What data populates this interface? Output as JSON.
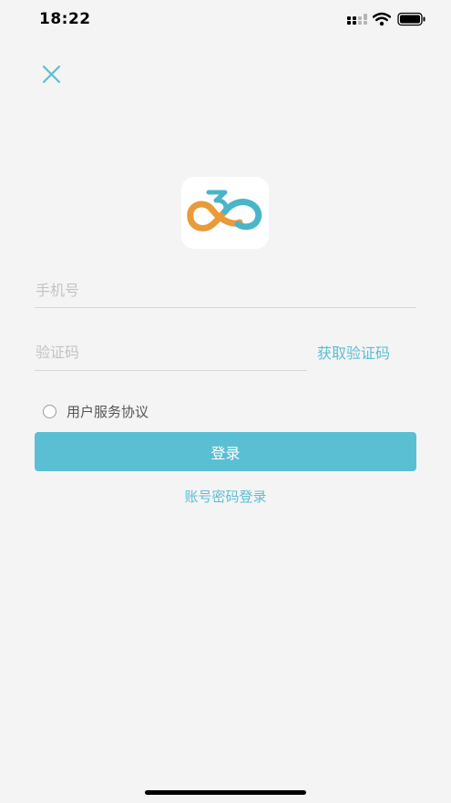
{
  "status_bar": {
    "time": "18:22"
  },
  "icons": {
    "close": "close-icon",
    "signal": "cellular-signal-icon",
    "wifi": "wifi-icon",
    "battery": "battery-icon",
    "logo": "app-logo-360-icon"
  },
  "colors": {
    "accent": "#5bbfd3",
    "logo_orange": "#e99a3a",
    "logo_teal": "#4ab5c8",
    "background": "#f4f4f4"
  },
  "form": {
    "phone_placeholder": "手机号",
    "code_placeholder": "验证码",
    "get_code_label": "获取验证码",
    "agreement_label": "用户服务协议",
    "login_label": "登录",
    "password_login_label": "账号密码登录"
  }
}
